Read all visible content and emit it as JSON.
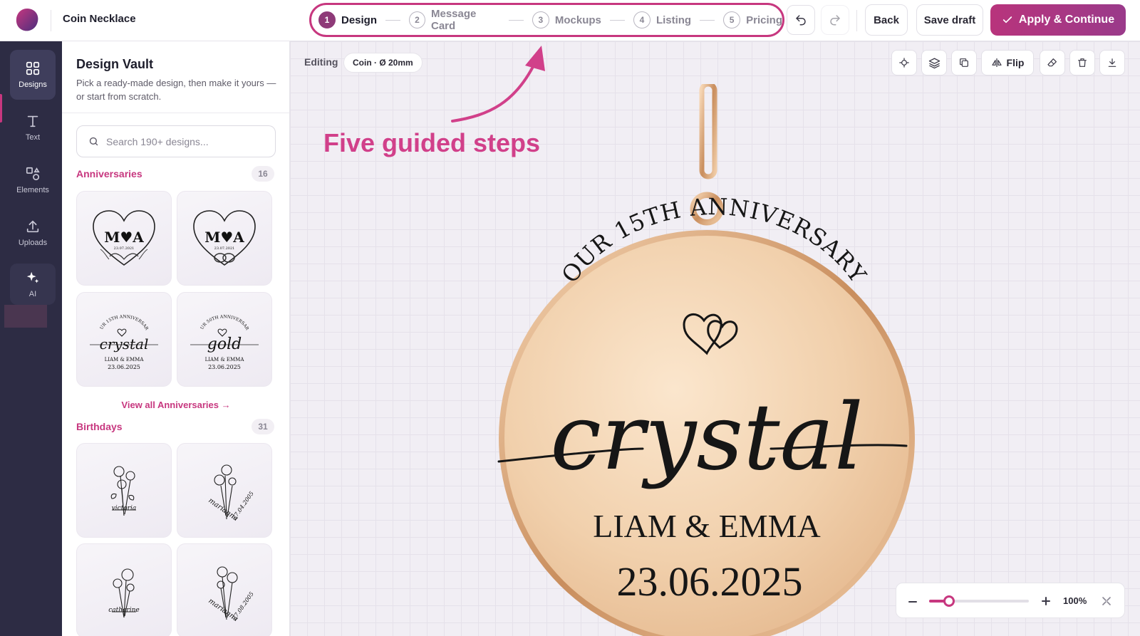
{
  "header": {
    "project_title": "Coin Necklace",
    "steps": [
      {
        "num": "1",
        "label": "Design"
      },
      {
        "num": "2",
        "label": "Message Card"
      },
      {
        "num": "3",
        "label": "Mockups"
      },
      {
        "num": "4",
        "label": "Listing"
      },
      {
        "num": "5",
        "label": "Pricing"
      }
    ],
    "active_step": "Design",
    "back_label": "Back",
    "save_draft_label": "Save draft",
    "apply_label": "Apply & Continue",
    "accent_color": "#c7377f"
  },
  "rail": {
    "items": [
      {
        "label": "Designs",
        "icon": "grid-icon"
      },
      {
        "label": "Text",
        "icon": "text-icon"
      },
      {
        "label": "Elements",
        "icon": "shapes-icon"
      },
      {
        "label": "Uploads",
        "icon": "upload-icon"
      },
      {
        "label": "AI",
        "icon": "sparkle-icon"
      }
    ],
    "active": "Designs"
  },
  "panel": {
    "title": "Design Vault",
    "subtitle": "Pick a ready-made design, then make it yours — or start from scratch.",
    "search_placeholder": "Search 190+ designs...",
    "categories": [
      {
        "name": "Anniversaries",
        "count": "16",
        "tiles": [
          {
            "monogram": "M♥A",
            "date": "23.07.2021"
          },
          {
            "monogram": "M♥A",
            "date": "23.07.2021"
          },
          {
            "arc": "OUR 15TH ANNIVERSARY",
            "word": "crystal",
            "names": "LIAM & EMMA",
            "date": "23.06.2025"
          },
          {
            "arc": "OUR 50TH ANNIVERSARY",
            "word": "gold",
            "names": "LIAM & EMMA",
            "date": "23.06.2025"
          }
        ],
        "view_all": "View all Anniversaries →"
      },
      {
        "name": "Birthdays",
        "count": "31",
        "tiles": [
          {
            "script": "victoria"
          },
          {
            "script": "marianna",
            "date": "27.04.2005"
          },
          {
            "script": "catherine"
          },
          {
            "script": "marianna",
            "date": "27.08.2005"
          }
        ]
      }
    ]
  },
  "canvas": {
    "editing_label": "Editing",
    "size_chip": "Coin · Ø 20mm",
    "flip_label": "Flip",
    "annotation": "Five guided steps",
    "pendant": {
      "arc_text": "OUR 15TH ANNIVERSARY",
      "script_word": "crystal",
      "names": "LIAM & EMMA",
      "date": "23.06.2025"
    },
    "zoom": {
      "label": "100%",
      "value": 100
    }
  }
}
